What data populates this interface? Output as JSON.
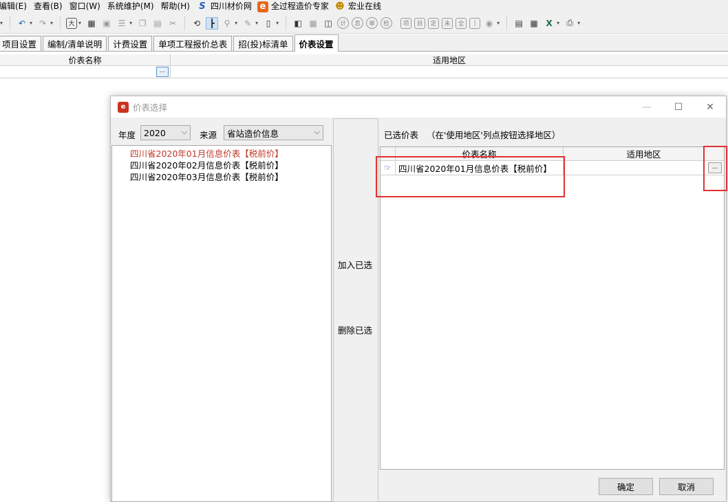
{
  "menu": {
    "items": [
      "编辑(E)",
      "查看(B)",
      "窗口(W)",
      "系统维护(M)",
      "帮助(H)"
    ],
    "links": [
      {
        "label": "四川材价网",
        "icon": "sichuan-s-logo-icon"
      },
      {
        "label": "全过程造价专家",
        "icon": "orange-e-logo-icon"
      },
      {
        "label": "宏业在线",
        "icon": "user-online-icon"
      }
    ]
  },
  "tabs": [
    "项目设置",
    "编制/清单说明",
    "计费设置",
    "单项工程报价总表",
    "招(投)标清单",
    "价表设置"
  ],
  "active_tab": "价表设置",
  "main_grid": {
    "columns": [
      "价表名称",
      "适用地区"
    ],
    "ellipsis": "..."
  },
  "dialog": {
    "title": "价表选择",
    "year_label": "年度",
    "year_value": "2020",
    "source_label": "来源",
    "source_value": "省站造价信息",
    "list_items": [
      {
        "label": "四川省2020年01月信息价表【税前价】",
        "selected": true
      },
      {
        "label": "四川省2020年02月信息价表【税前价】",
        "selected": false
      },
      {
        "label": "四川省2020年03月信息价表【税前价】",
        "selected": false
      }
    ],
    "add_button": "加入已选",
    "remove_button": "删除已选",
    "selected_label": "已选价表",
    "selected_hint": "（在'使用地区'列点按钮选择地区）",
    "selected_columns": [
      "价表名称",
      "适用地区"
    ],
    "selected_rows": [
      {
        "name": "四川省2020年01月信息价表【税前价】",
        "region": ""
      }
    ],
    "row_ellipsis": "...",
    "ok_button": "确定",
    "cancel_button": "取消"
  },
  "colors": {
    "highlight_box": "#e03131",
    "selected_item": "#c0392b",
    "dialog_bg": "#f0f0f0"
  }
}
